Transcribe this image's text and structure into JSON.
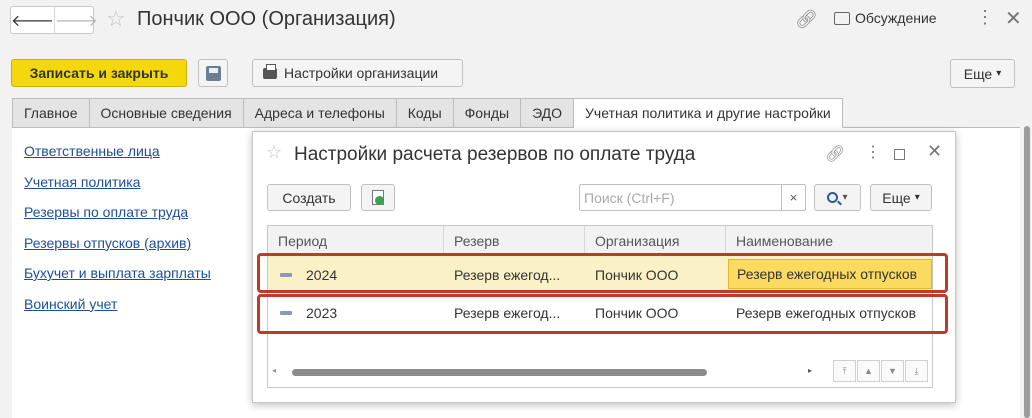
{
  "window": {
    "title": "Пончик ООО (Организация)",
    "discuss_label": "Обсуждение"
  },
  "toolbar": {
    "save_close_label": "Записать и закрыть",
    "org_settings_label": "Настройки организации",
    "more_label": "Еще",
    "more_arrow": "▾"
  },
  "tabs": [
    {
      "label": "Главное"
    },
    {
      "label": "Основные сведения"
    },
    {
      "label": "Адреса и телефоны"
    },
    {
      "label": "Коды"
    },
    {
      "label": "Фонды"
    },
    {
      "label": "ЭДО"
    },
    {
      "label": "Учетная политика и другие настройки",
      "active": true
    }
  ],
  "left_links": [
    {
      "label": "Ответственные лица"
    },
    {
      "label": "Учетная политика"
    },
    {
      "label": "Резервы по оплате труда"
    },
    {
      "label": "Резервы отпусков (архив)"
    },
    {
      "label": "Бухучет и выплата зарплаты"
    },
    {
      "label": "Воинский учет"
    }
  ],
  "dialog": {
    "title": "Настройки расчета резервов по оплате труда",
    "create_label": "Создать",
    "search_placeholder": "Поиск (Ctrl+F)",
    "clear_label": "×",
    "more_label": "Еще",
    "columns": [
      "Период",
      "Резерв",
      "Организация",
      "Наименование"
    ],
    "rows": [
      {
        "period": "2024",
        "reserve": "Резерв ежегод...",
        "organization": "Пончик ООО",
        "name": "Резерв ежегодных отпусков",
        "selected": true
      },
      {
        "period": "2023",
        "reserve": "Резерв ежегод...",
        "organization": "Пончик ООО",
        "name": "Резерв ежегодных отпусков",
        "selected": false
      }
    ]
  },
  "icons": {
    "back": "arrow-left-icon",
    "forward": "arrow-right-icon",
    "favorite": "star-icon",
    "link": "link-icon",
    "discuss": "chat-icon",
    "more": "more-vertical-icon",
    "close": "close-icon",
    "save": "floppy-disk-icon",
    "print": "printer-icon",
    "copy": "copy-document-icon",
    "search": "search-icon"
  },
  "colors": {
    "primary_button": "#f5d80c",
    "link": "#1f4e99",
    "selected_row": "#fbf1c6",
    "selected_cell": "#fadb60",
    "annotation": "#c0392b"
  }
}
